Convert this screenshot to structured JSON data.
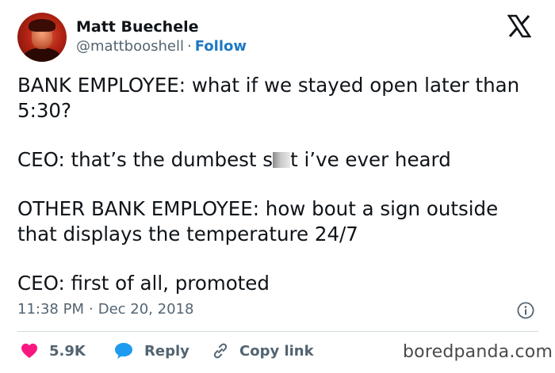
{
  "author": {
    "name": "Matt Buechele",
    "handle": "@mattbooshell",
    "separator": "·",
    "follow_label": "Follow"
  },
  "tweet": {
    "line1": "BANK EMPLOYEE: what if we stayed open later than 5:30?",
    "line2_before": "CEO: that’s the dumbest s",
    "line2_after": "t i’ve ever heard",
    "line3": "OTHER BANK EMPLOYEE: how bout a sign outside that displays the temperature 24/7",
    "line4": "CEO: first of all, promoted"
  },
  "meta": {
    "time": "11:38 PM",
    "separator": "·",
    "date": "Dec 20, 2018"
  },
  "actions": {
    "like_count": "5.9K",
    "reply_label": "Reply",
    "copy_link_label": "Copy link"
  },
  "watermark": "boredpanda.com",
  "colors": {
    "like": "#f91880",
    "reply": "#1d9bf0",
    "follow": "#1d78c5",
    "muted": "#536471"
  },
  "icons": {
    "platform": "x-logo-icon",
    "like": "heart-icon",
    "reply": "speech-bubble-icon",
    "copy_link": "link-icon",
    "info": "info-icon"
  }
}
